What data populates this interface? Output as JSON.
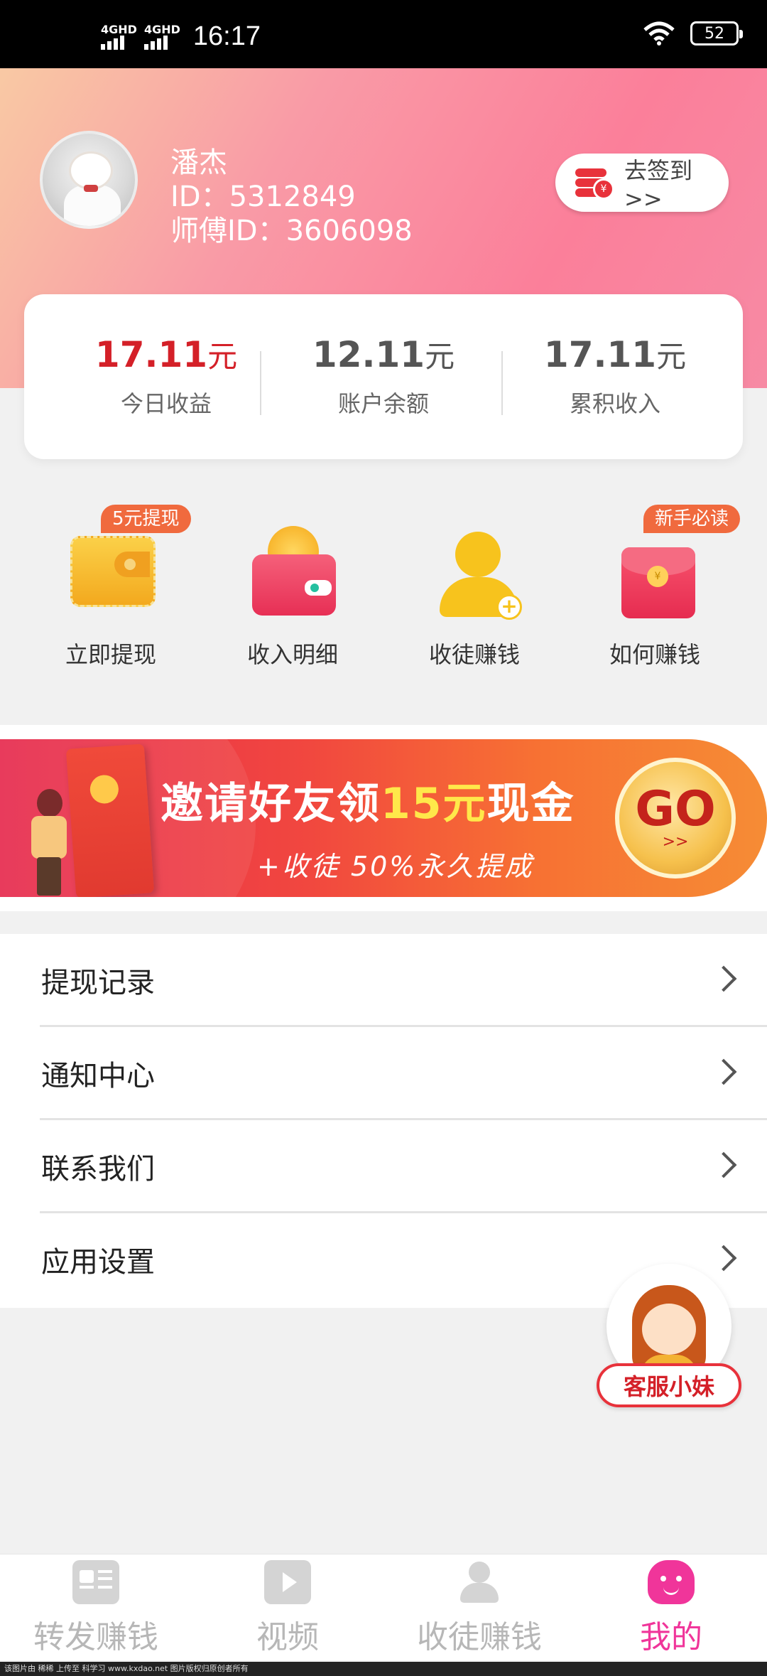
{
  "status_bar": {
    "network_1": "4GHD",
    "network_2": "4GHD",
    "time": "16:17",
    "battery": "52"
  },
  "profile": {
    "name": "潘杰",
    "id": "ID：5312849",
    "master_id": "师傅ID：3606098",
    "checkin_label": "去签到>>"
  },
  "stats": [
    {
      "value": "17.11",
      "unit": "元",
      "label": "今日收益"
    },
    {
      "value": "12.11",
      "unit": "元",
      "label": "账户余额"
    },
    {
      "value": "17.11",
      "unit": "元",
      "label": "累积收入"
    }
  ],
  "actions": [
    {
      "label": "立即提现",
      "badge": "5元提现",
      "icon": "wallet-icon"
    },
    {
      "label": "收入明细",
      "badge": "",
      "icon": "purse-icon"
    },
    {
      "label": "收徒赚钱",
      "badge": "",
      "icon": "add-user-icon"
    },
    {
      "label": "如何赚钱",
      "badge": "新手必读",
      "icon": "red-packet-icon"
    }
  ],
  "banner": {
    "title_pre": "邀请好友领",
    "title_highlight": "15元",
    "title_post": "现金",
    "subtitle": "+收徒 50%永久提成",
    "go_label": "GO",
    "go_arrows": ">>"
  },
  "menu": [
    {
      "label": "提现记录"
    },
    {
      "label": "通知中心"
    },
    {
      "label": "联系我们"
    },
    {
      "label": "应用设置"
    }
  ],
  "customer_service": {
    "label": "客服小妹"
  },
  "bottom_nav": [
    {
      "label": "转发赚钱",
      "icon": "news-icon",
      "active": false
    },
    {
      "label": "视频",
      "icon": "video-icon",
      "active": false
    },
    {
      "label": "收徒赚钱",
      "icon": "add-user-icon",
      "active": false
    },
    {
      "label": "我的",
      "icon": "me-icon",
      "active": true
    }
  ],
  "footer_watermark": "该图片由 稀稀 上传至 科学习 www.kxdao.net 图片版权归原创者所有",
  "colors": {
    "accent_red": "#d42028",
    "active_pink": "#f0359a",
    "badge_orange": "#f06a3e"
  }
}
